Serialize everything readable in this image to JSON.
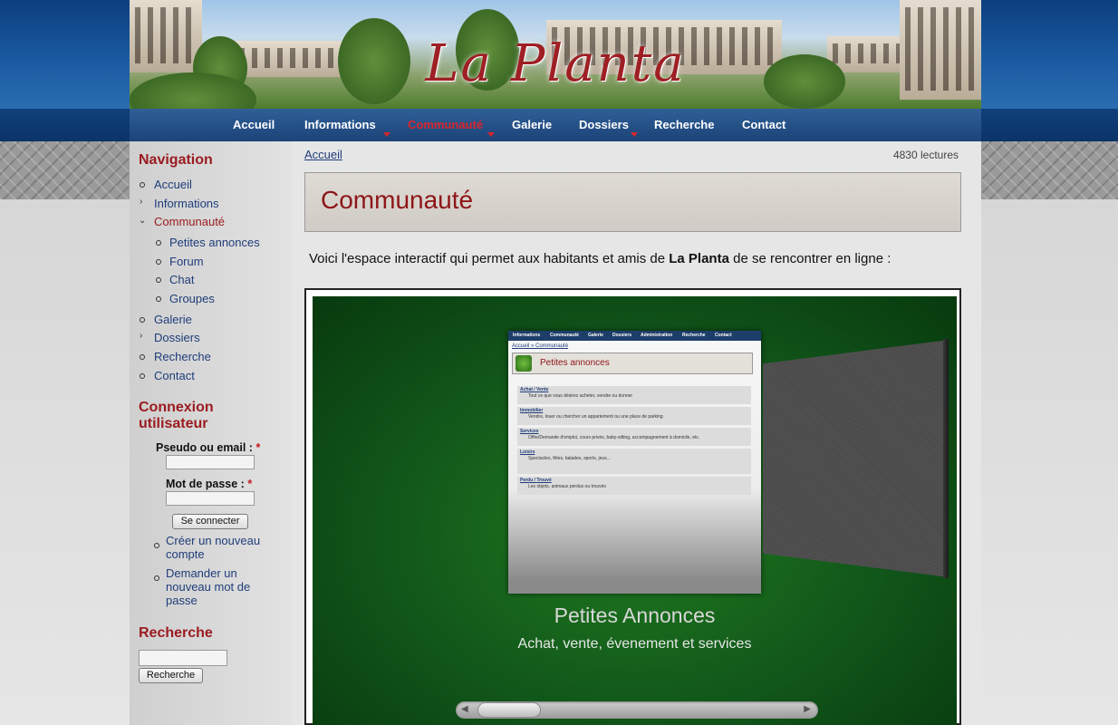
{
  "banner": {
    "title": "La Planta"
  },
  "nav": {
    "items": [
      {
        "label": "Accueil"
      },
      {
        "label": "Informations"
      },
      {
        "label": "Communauté"
      },
      {
        "label": "Galerie"
      },
      {
        "label": "Dossiers"
      },
      {
        "label": "Recherche"
      },
      {
        "label": "Contact"
      }
    ],
    "active_color": "#d8262b"
  },
  "sidebar": {
    "navigation": {
      "heading": "Navigation",
      "items": [
        {
          "label": "Accueil"
        },
        {
          "label": "Informations"
        },
        {
          "label": "Communauté"
        },
        {
          "label": "Petites annonces"
        },
        {
          "label": "Forum"
        },
        {
          "label": "Chat"
        },
        {
          "label": "Groupes"
        },
        {
          "label": "Galerie"
        },
        {
          "label": "Dossiers"
        },
        {
          "label": "Recherche"
        },
        {
          "label": "Contact"
        }
      ]
    },
    "login": {
      "heading_line1": "Connexion",
      "heading_line2": "utilisateur",
      "username_label": "Pseudo ou email :",
      "password_label": "Mot de passe :",
      "required_mark": "*",
      "username_value": "",
      "password_value": "",
      "submit_label": "Se connecter",
      "create_account_line1": "Créer un nouveau",
      "create_account_line2": "compte",
      "reset_line1": "Demander un",
      "reset_line2": "nouveau mot de",
      "reset_line3": "passe"
    },
    "search": {
      "heading": "Recherche",
      "value": "",
      "button_label": "Recherche"
    }
  },
  "main": {
    "breadcrumb": "Accueil",
    "reads": "4830 lectures",
    "title": "Communauté",
    "intro_before": "Voici l'espace interactif qui permet aux habitants et amis de ",
    "intro_bold": "La Planta",
    "intro_after": " de se rencontrer en ligne :",
    "carousel": {
      "preview": {
        "nav": [
          "Informations",
          "Communauté",
          "Galerie",
          "Dossiers",
          "Administration",
          "Recherche",
          "Contact"
        ],
        "breadcrumb": "Accueil » Communauté",
        "title": "Petites annonces",
        "rows": [
          {
            "title": "Achat / Vente",
            "desc": "Tout ce que vous désirez acheter, vendre ou donner"
          },
          {
            "title": "Immobilier",
            "desc": "Vendre, louer ou chercher un appartement ou une place de parking"
          },
          {
            "title": "Services",
            "desc": "Offre/Demande d'emploi, cours privés, baby-sitting, accompagnement à domicile, etc."
          },
          {
            "title": "Loisirs",
            "desc": "Spectacles, fêtes, balades, sports, jeux..."
          },
          {
            "title": "Perdu / Trouvé",
            "desc": "Les objets, animaux perdus ou trouvés"
          }
        ]
      },
      "title": "Petites Annonces",
      "subtitle": "Achat, vente, évenement et services"
    }
  }
}
